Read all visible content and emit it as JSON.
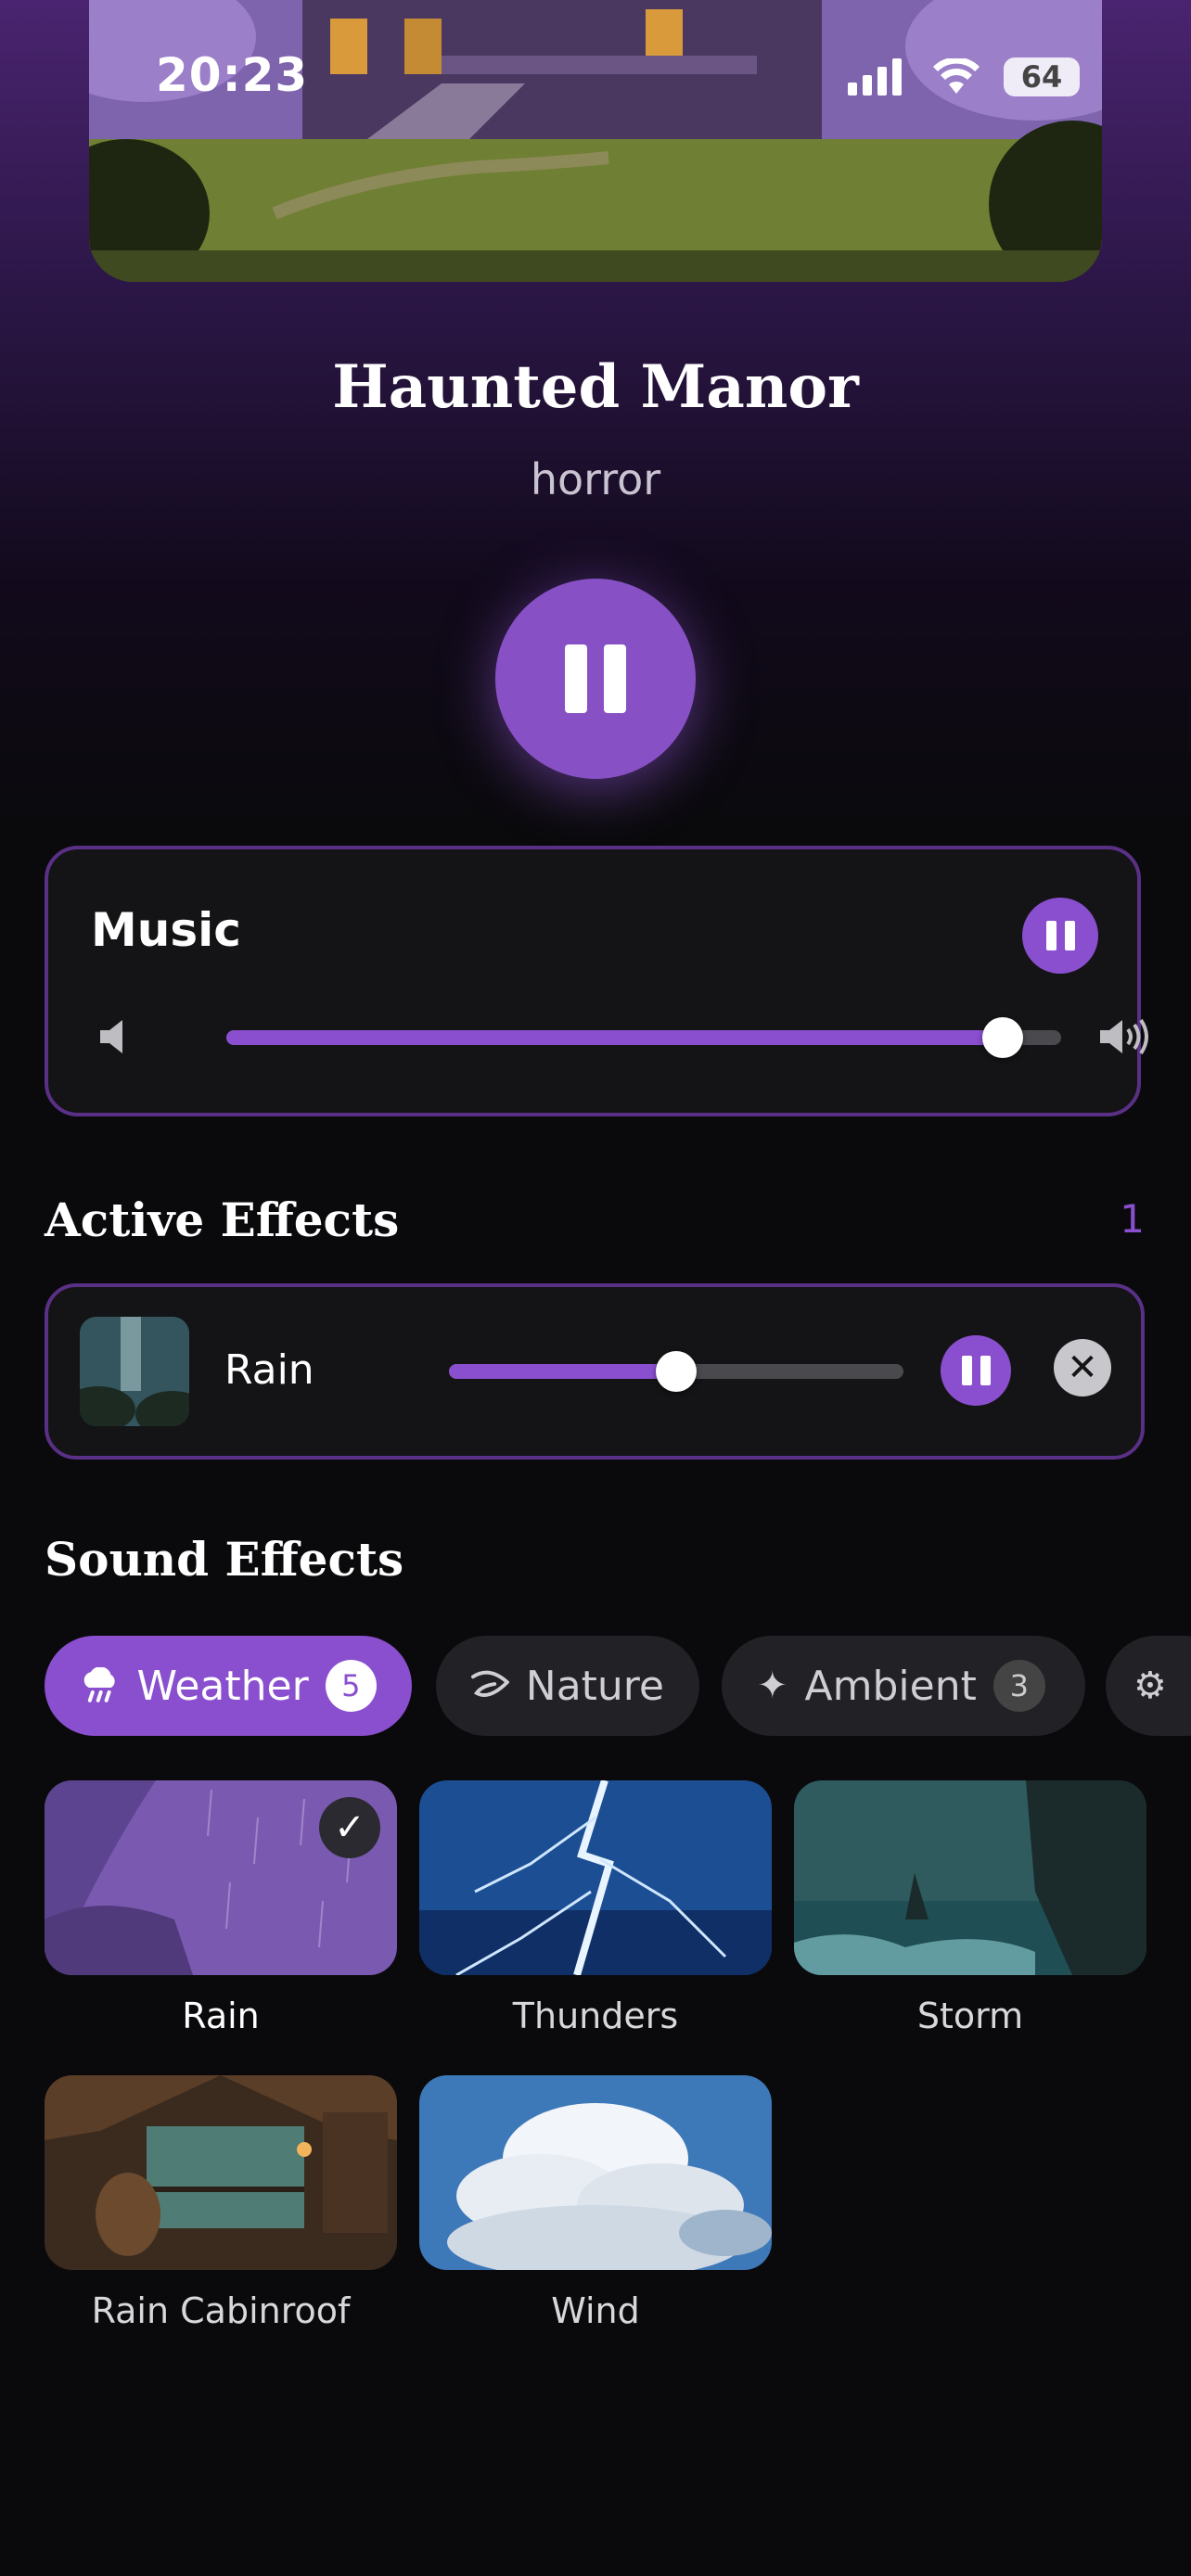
{
  "status_bar": {
    "time": "20:23",
    "battery": "64"
  },
  "now_playing": {
    "title": "Haunted Manor",
    "genre": "horror"
  },
  "music": {
    "label": "Music",
    "volume": 0.93
  },
  "active_effects": {
    "heading": "Active Effects",
    "count": "1",
    "items": [
      {
        "name": "Rain",
        "volume": 0.5
      }
    ]
  },
  "sound_effects": {
    "heading": "Sound Effects",
    "categories": [
      {
        "label": "Weather",
        "badge": "5",
        "icon": "rain-cloud-icon",
        "active": true
      },
      {
        "label": "Nature",
        "icon": "leaf-icon",
        "active": false
      },
      {
        "label": "Ambient",
        "badge": "3",
        "icon": "sparkle-icon",
        "active": false
      },
      {
        "icon": "gear-icon",
        "active": false
      }
    ],
    "tiles": [
      {
        "label": "Rain",
        "selected": true
      },
      {
        "label": "Thunders",
        "selected": false
      },
      {
        "label": "Storm",
        "selected": false
      },
      {
        "label": "Rain Cabinroof",
        "selected": false
      },
      {
        "label": "Wind",
        "selected": false
      }
    ]
  },
  "colors": {
    "accent": "#8a4fcf",
    "card_border": "#5a2f86",
    "background": "#0a0a0c"
  }
}
